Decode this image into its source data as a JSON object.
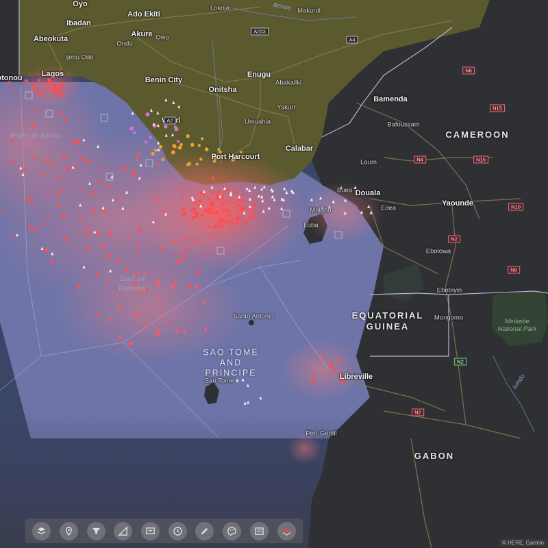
{
  "colors": {
    "land_dark": "#2f3034",
    "land_nigeria": "#5b5a2f",
    "ocean": "#6e74a8",
    "ocean_deep": "#3e4a6a",
    "heat": "#ff5a5a",
    "incident_red": "#ff4d4d",
    "incident_orange": "#f0a030",
    "incident_pink": "#e070d0",
    "road": "#8f7c55",
    "border": "#b8b0d8"
  },
  "labels": {
    "countries": {
      "cameroon": "CAMEROON",
      "equatorial_guinea": "EQUATORIAL\nGUINEA",
      "gabon": "GABON"
    },
    "islands": {
      "sao_tome_principe": "SAO TOME\nAND\nPRINCIPE"
    },
    "water": {
      "gulf_of_guinea": "Gulf of\nGuinea",
      "bight_of_benin": "Bight of Benin"
    },
    "park": {
      "minkebe": "Minkebe\nNational Park"
    },
    "rivers": {
      "benue": "Benue",
      "ivindo": "Ivindo"
    },
    "cities": [
      {
        "id": "oyo",
        "name": "Oyo"
      },
      {
        "id": "ado-ekiti",
        "name": "Ado Ekiti"
      },
      {
        "id": "ibadan",
        "name": "Ibadan"
      },
      {
        "id": "abeokuta",
        "name": "Abeokuta"
      },
      {
        "id": "akure",
        "name": "Akure"
      },
      {
        "id": "lagos",
        "name": "Lagos"
      },
      {
        "id": "porto-novo",
        "name": "otonou"
      },
      {
        "id": "benin-city",
        "name": "Benin City"
      },
      {
        "id": "onitsha",
        "name": "Onitsha"
      },
      {
        "id": "enugu",
        "name": "Enugu"
      },
      {
        "id": "warri",
        "name": "Warri"
      },
      {
        "id": "port-harcourt",
        "name": "Port Harcourt"
      },
      {
        "id": "calabar",
        "name": "Calabar"
      },
      {
        "id": "bamenda",
        "name": "Bamenda"
      },
      {
        "id": "douala",
        "name": "Douala"
      },
      {
        "id": "yaounde",
        "name": "Yaounde"
      },
      {
        "id": "libreville",
        "name": "Libreville"
      }
    ],
    "towns": [
      {
        "id": "lokoja",
        "name": "Lokoja"
      },
      {
        "id": "makurdi",
        "name": "Makurdi"
      },
      {
        "id": "ondo",
        "name": "Ondo"
      },
      {
        "id": "owo",
        "name": "Owo"
      },
      {
        "id": "ijebu-ode",
        "name": "Ijebu Ode"
      },
      {
        "id": "abakaliki",
        "name": "Abakaliki"
      },
      {
        "id": "yakurr",
        "name": "Yakurr"
      },
      {
        "id": "umuahia",
        "name": "Umuahia"
      },
      {
        "id": "bafoussam",
        "name": "Bafoussam"
      },
      {
        "id": "loum",
        "name": "Loum"
      },
      {
        "id": "buea",
        "name": "Buea"
      },
      {
        "id": "edea",
        "name": "Edea"
      },
      {
        "id": "malabo",
        "name": "Malabo"
      },
      {
        "id": "luba",
        "name": "Luba"
      },
      {
        "id": "ebolowa",
        "name": "Ebolowa"
      },
      {
        "id": "ebebiyin",
        "name": "Ebebiyin"
      },
      {
        "id": "mongomo",
        "name": "Mongomo"
      },
      {
        "id": "santo-antonio",
        "name": "Santo Antonio"
      },
      {
        "id": "sao-tome",
        "name": "Sao Tome"
      },
      {
        "id": "port-gentil",
        "name": "Port-Gentil"
      }
    ],
    "shields": [
      {
        "id": "a233",
        "name": "A233",
        "style": "dark"
      },
      {
        "id": "a4",
        "name": "A4",
        "style": "dark"
      },
      {
        "id": "a2",
        "name": "A2",
        "style": "dark"
      },
      {
        "id": "n6",
        "name": "N6",
        "style": "red"
      },
      {
        "id": "n15",
        "name": "N15",
        "style": "red"
      },
      {
        "id": "n4",
        "name": "N4",
        "style": "red"
      },
      {
        "id": "n15b",
        "name": "N15",
        "style": "red"
      },
      {
        "id": "n10",
        "name": "N10",
        "style": "red"
      },
      {
        "id": "n2",
        "name": "N2",
        "style": "red"
      },
      {
        "id": "n9",
        "name": "N9",
        "style": "red"
      },
      {
        "id": "n2b",
        "name": "N2",
        "style": "green"
      },
      {
        "id": "n2c",
        "name": "N2",
        "style": "red"
      }
    ]
  },
  "toolbar": {
    "buttons": [
      {
        "id": "basemap",
        "icon": "basemap-icon"
      },
      {
        "id": "location",
        "icon": "location-pin-icon"
      },
      {
        "id": "filter",
        "icon": "filter-icon"
      },
      {
        "id": "measure",
        "icon": "measure-icon"
      },
      {
        "id": "layers",
        "icon": "layers-icon"
      },
      {
        "id": "time",
        "icon": "clock-icon"
      },
      {
        "id": "draw",
        "icon": "pencil-icon"
      },
      {
        "id": "style",
        "icon": "palette-icon"
      },
      {
        "id": "legend",
        "icon": "legend-icon"
      },
      {
        "id": "print",
        "icon": "print-icon"
      }
    ]
  },
  "attribution": "© HERE, Garmin"
}
